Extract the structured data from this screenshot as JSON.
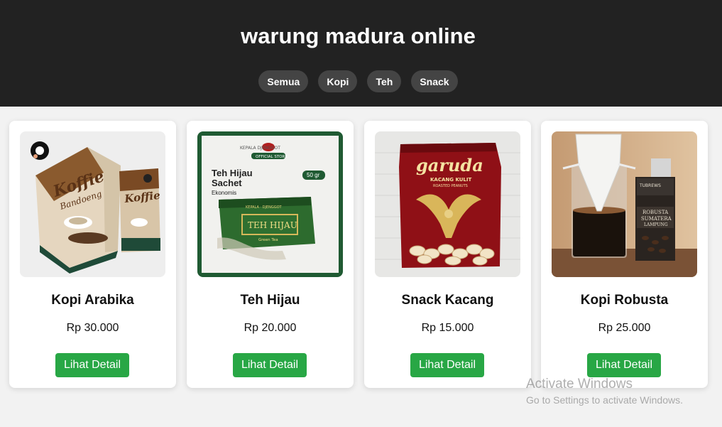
{
  "site": {
    "title": "warung madura online"
  },
  "nav": {
    "items": [
      {
        "label": "Semua"
      },
      {
        "label": "Kopi"
      },
      {
        "label": "Teh"
      },
      {
        "label": "Snack"
      }
    ]
  },
  "products": [
    {
      "name": "Kopi Arabika",
      "price": "Rp 30.000",
      "button": "Lihat Detail",
      "image": {
        "brand_mark": "Koffie",
        "sub_mark": "Bandoeng"
      }
    },
    {
      "name": "Teh Hijau",
      "price": "Rp 20.000",
      "button": "Lihat Detail",
      "image": {
        "brand_line": "KEPALA DJENGGOT",
        "store_badge": "OFFICIAL STORE",
        "title_line1": "Teh Hijau",
        "title_line2": "Sachet",
        "subtitle": "Ekonomis",
        "weight": "50 gr",
        "pack_label": "TEH HIJAU",
        "pack_sub": "Green Tea"
      }
    },
    {
      "name": "Snack Kacang",
      "price": "Rp 15.000",
      "button": "Lihat Detail",
      "image": {
        "brand": "garuda",
        "sub": "KACANG KULIT",
        "sub2": "ROASTED PEANUTS"
      }
    },
    {
      "name": "Kopi Robusta",
      "price": "Rp 25.000",
      "button": "Lihat Detail",
      "image": {
        "brand": "TUBREWS",
        "label_line1": "ROBUSTA",
        "label_line2": "SUMATERA",
        "label_line3": "LAMPUNG"
      }
    }
  ],
  "watermark": {
    "title": "Activate Windows",
    "subtitle": "Go to Settings to activate Windows."
  },
  "colors": {
    "header_bg": "#222222",
    "nav_button_bg": "#444444",
    "accent_green": "#28a745",
    "page_bg": "#f2f2f2"
  }
}
